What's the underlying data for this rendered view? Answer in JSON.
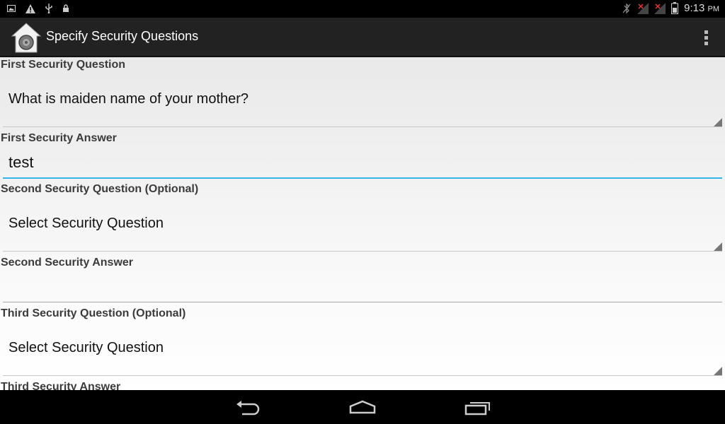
{
  "status_bar": {
    "time": "9:13",
    "ampm": "PM",
    "left_icons": [
      "image-icon",
      "warning-icon",
      "usb-icon",
      "lock-icon"
    ],
    "right_icons": [
      "bluetooth-muted-icon",
      "signal-icon",
      "signal-icon",
      "battery-icon"
    ]
  },
  "action_bar": {
    "title": "Specify Security Questions",
    "app_icon": "safe-home-icon",
    "overflow_icon": "overflow-menu-icon"
  },
  "form": {
    "q1_label": "First Security Question",
    "q1_value": "What is maiden name of your mother?",
    "a1_label": "First Security Answer",
    "a1_value": "test",
    "q2_label": "Second Security Question (Optional)",
    "q2_value": "Select Security Question",
    "a2_label": "Second Security Answer",
    "a2_value": "",
    "q3_label": "Third Security Question (Optional)",
    "q3_value": "Select Security Question",
    "a3_label": "Third Security Answer"
  },
  "nav_bar": {
    "buttons": [
      "back-icon",
      "home-icon",
      "recent-apps-icon"
    ]
  },
  "colors": {
    "focus_accent": "#33b5e5",
    "action_bar": "#222222",
    "status_bar": "#000000"
  }
}
